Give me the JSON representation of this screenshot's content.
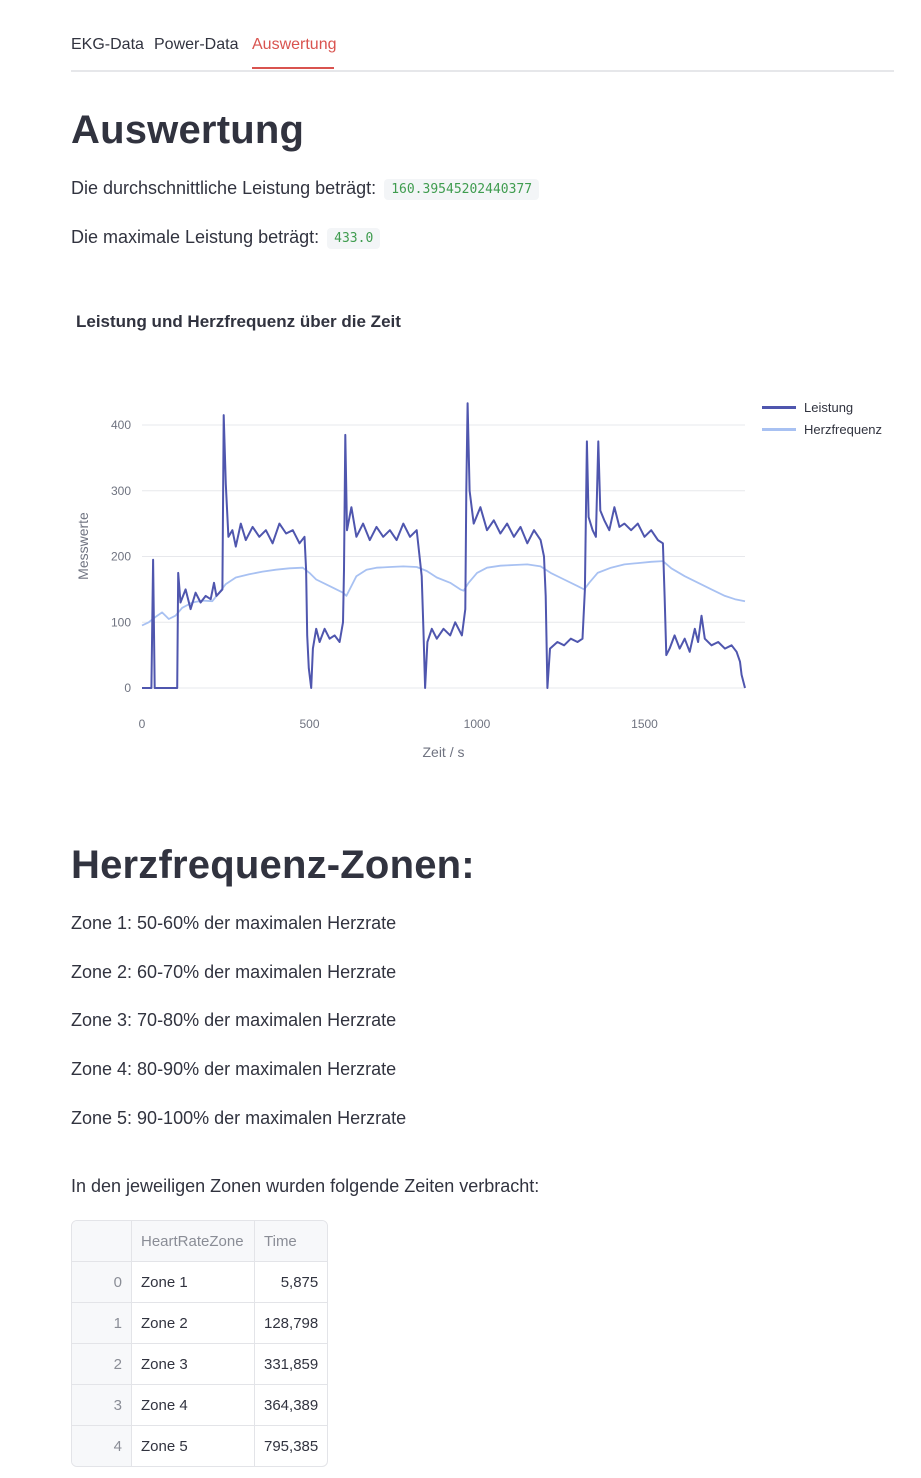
{
  "tabs": [
    {
      "label": "EKG-Data",
      "active": false
    },
    {
      "label": "Power-Data",
      "active": false
    },
    {
      "label": "Auswertung",
      "active": true
    }
  ],
  "header": {
    "title": "Auswertung"
  },
  "stats": {
    "avg_label": "Die durchschnittliche Leistung beträgt:",
    "avg_value": "160.39545202440377",
    "max_label": "Die maximale Leistung beträgt:",
    "max_value": "433.0"
  },
  "chart_data": {
    "type": "line",
    "title": "Leistung und Herzfrequenz über die Zeit",
    "xlabel": "Zeit / s",
    "ylabel": "Messwerte",
    "xlim": [
      0,
      1800
    ],
    "ylim": [
      0,
      420
    ],
    "xticks": [
      0,
      500,
      1000,
      1500
    ],
    "yticks": [
      0,
      100,
      200,
      300,
      400
    ],
    "grid": true,
    "legend_position": "top-right",
    "series": [
      {
        "name": "Leistung",
        "color": "#4f56ae",
        "points": [
          [
            0,
            0
          ],
          [
            28,
            0
          ],
          [
            33,
            195
          ],
          [
            38,
            0
          ],
          [
            105,
            0
          ],
          [
            108,
            175
          ],
          [
            115,
            130
          ],
          [
            130,
            150
          ],
          [
            145,
            120
          ],
          [
            160,
            145
          ],
          [
            175,
            130
          ],
          [
            190,
            140
          ],
          [
            205,
            135
          ],
          [
            215,
            160
          ],
          [
            222,
            140
          ],
          [
            240,
            150
          ],
          [
            244,
            415
          ],
          [
            250,
            310
          ],
          [
            258,
            230
          ],
          [
            270,
            240
          ],
          [
            280,
            215
          ],
          [
            295,
            250
          ],
          [
            310,
            225
          ],
          [
            330,
            245
          ],
          [
            350,
            230
          ],
          [
            370,
            240
          ],
          [
            390,
            220
          ],
          [
            410,
            250
          ],
          [
            430,
            235
          ],
          [
            450,
            240
          ],
          [
            470,
            220
          ],
          [
            485,
            230
          ],
          [
            490,
            180
          ],
          [
            493,
            80
          ],
          [
            498,
            30
          ],
          [
            505,
            0
          ],
          [
            510,
            60
          ],
          [
            520,
            90
          ],
          [
            530,
            70
          ],
          [
            545,
            90
          ],
          [
            560,
            75
          ],
          [
            575,
            80
          ],
          [
            590,
            70
          ],
          [
            600,
            100
          ],
          [
            603,
            180
          ],
          [
            607,
            385
          ],
          [
            612,
            240
          ],
          [
            625,
            275
          ],
          [
            640,
            230
          ],
          [
            660,
            250
          ],
          [
            680,
            225
          ],
          [
            700,
            245
          ],
          [
            720,
            230
          ],
          [
            740,
            240
          ],
          [
            760,
            225
          ],
          [
            780,
            250
          ],
          [
            800,
            230
          ],
          [
            820,
            240
          ],
          [
            835,
            170
          ],
          [
            840,
            90
          ],
          [
            845,
            0
          ],
          [
            852,
            70
          ],
          [
            865,
            90
          ],
          [
            880,
            75
          ],
          [
            900,
            90
          ],
          [
            920,
            80
          ],
          [
            935,
            100
          ],
          [
            955,
            80
          ],
          [
            965,
            120
          ],
          [
            968,
            300
          ],
          [
            972,
            433
          ],
          [
            978,
            300
          ],
          [
            990,
            250
          ],
          [
            1010,
            275
          ],
          [
            1030,
            240
          ],
          [
            1050,
            255
          ],
          [
            1070,
            235
          ],
          [
            1090,
            250
          ],
          [
            1110,
            230
          ],
          [
            1130,
            245
          ],
          [
            1150,
            220
          ],
          [
            1170,
            240
          ],
          [
            1190,
            225
          ],
          [
            1200,
            200
          ],
          [
            1205,
            140
          ],
          [
            1210,
            0
          ],
          [
            1218,
            60
          ],
          [
            1240,
            70
          ],
          [
            1260,
            65
          ],
          [
            1280,
            75
          ],
          [
            1300,
            70
          ],
          [
            1315,
            75
          ],
          [
            1322,
            150
          ],
          [
            1328,
            375
          ],
          [
            1333,
            260
          ],
          [
            1345,
            240
          ],
          [
            1355,
            230
          ],
          [
            1362,
            375
          ],
          [
            1368,
            270
          ],
          [
            1380,
            255
          ],
          [
            1395,
            240
          ],
          [
            1410,
            275
          ],
          [
            1425,
            245
          ],
          [
            1440,
            250
          ],
          [
            1460,
            240
          ],
          [
            1480,
            250
          ],
          [
            1500,
            230
          ],
          [
            1520,
            240
          ],
          [
            1540,
            225
          ],
          [
            1555,
            220
          ],
          [
            1560,
            140
          ],
          [
            1565,
            50
          ],
          [
            1575,
            60
          ],
          [
            1590,
            80
          ],
          [
            1605,
            60
          ],
          [
            1620,
            75
          ],
          [
            1635,
            55
          ],
          [
            1650,
            90
          ],
          [
            1660,
            70
          ],
          [
            1670,
            110
          ],
          [
            1680,
            75
          ],
          [
            1700,
            65
          ],
          [
            1720,
            70
          ],
          [
            1740,
            60
          ],
          [
            1760,
            65
          ],
          [
            1775,
            55
          ],
          [
            1785,
            40
          ],
          [
            1790,
            20
          ],
          [
            1800,
            0
          ]
        ]
      },
      {
        "name": "Herzfrequenz",
        "color": "#a8c1f2",
        "points": [
          [
            0,
            95
          ],
          [
            20,
            100
          ],
          [
            40,
            108
          ],
          [
            60,
            115
          ],
          [
            80,
            105
          ],
          [
            100,
            110
          ],
          [
            120,
            122
          ],
          [
            150,
            130
          ],
          [
            180,
            133
          ],
          [
            210,
            132
          ],
          [
            230,
            145
          ],
          [
            250,
            158
          ],
          [
            280,
            168
          ],
          [
            320,
            173
          ],
          [
            360,
            177
          ],
          [
            400,
            180
          ],
          [
            440,
            182
          ],
          [
            480,
            183
          ],
          [
            500,
            175
          ],
          [
            520,
            165
          ],
          [
            560,
            155
          ],
          [
            600,
            145
          ],
          [
            610,
            140
          ],
          [
            620,
            150
          ],
          [
            640,
            170
          ],
          [
            670,
            180
          ],
          [
            700,
            183
          ],
          [
            740,
            184
          ],
          [
            780,
            185
          ],
          [
            820,
            184
          ],
          [
            850,
            178
          ],
          [
            880,
            168
          ],
          [
            920,
            160
          ],
          [
            950,
            150
          ],
          [
            960,
            148
          ],
          [
            975,
            160
          ],
          [
            1000,
            175
          ],
          [
            1030,
            183
          ],
          [
            1070,
            186
          ],
          [
            1110,
            187
          ],
          [
            1150,
            188
          ],
          [
            1190,
            185
          ],
          [
            1220,
            175
          ],
          [
            1260,
            165
          ],
          [
            1300,
            155
          ],
          [
            1320,
            150
          ],
          [
            1335,
            160
          ],
          [
            1360,
            175
          ],
          [
            1400,
            183
          ],
          [
            1440,
            188
          ],
          [
            1480,
            190
          ],
          [
            1520,
            192
          ],
          [
            1555,
            193
          ],
          [
            1580,
            182
          ],
          [
            1620,
            170
          ],
          [
            1660,
            160
          ],
          [
            1700,
            150
          ],
          [
            1740,
            140
          ],
          [
            1770,
            135
          ],
          [
            1800,
            132
          ]
        ]
      }
    ]
  },
  "zones_section": {
    "title": "Herzfrequenz-Zonen:",
    "zones": [
      "Zone 1: 50-60% der maximalen Herzrate",
      "Zone 2: 60-70% der maximalen Herzrate",
      "Zone 3: 70-80% der maximalen Herzrate",
      "Zone 4: 80-90% der maximalen Herzrate",
      "Zone 5: 90-100% der maximalen Herzrate"
    ],
    "time_intro": "In den jeweiligen Zonen wurden folgende Zeiten verbracht:"
  },
  "table": {
    "columns": [
      "",
      "HeartRateZone",
      "Time"
    ],
    "rows": [
      {
        "index": "0",
        "zone": "Zone 1",
        "time": "5,875"
      },
      {
        "index": "1",
        "zone": "Zone 2",
        "time": "128,798"
      },
      {
        "index": "2",
        "zone": "Zone 3",
        "time": "331,859"
      },
      {
        "index": "3",
        "zone": "Zone 4",
        "time": "364,389"
      },
      {
        "index": "4",
        "zone": "Zone 5",
        "time": "795,385"
      }
    ]
  }
}
